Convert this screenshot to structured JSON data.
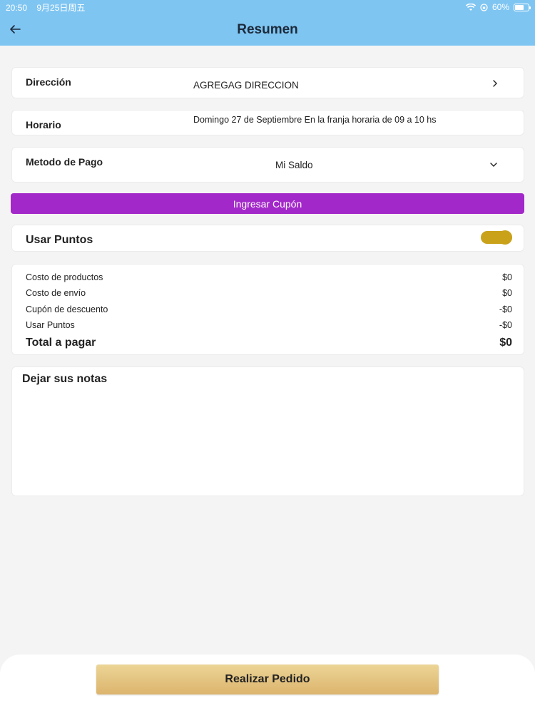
{
  "status_bar": {
    "time": "20:50",
    "date": "9月25日周五",
    "battery": "60%"
  },
  "header": {
    "title": "Resumen"
  },
  "address": {
    "label": "Dirección",
    "value": "AGREGAG DIRECCION"
  },
  "schedule": {
    "label": "Horario",
    "value": "Domingo 27 de Septiembre En la franja horaria de 09 a 10 hs"
  },
  "payment": {
    "label": "Metodo de Pago",
    "selected": "Mi Saldo"
  },
  "coupon_button": "Ingresar Cupón",
  "points": {
    "label": "Usar Puntos",
    "enabled": true,
    "toggle_color": "#c9a21a"
  },
  "summary": {
    "lines": [
      {
        "label": "Costo de productos",
        "value": "$0"
      },
      {
        "label": "Costo de envío",
        "value": "$0"
      },
      {
        "label": "Cupón de descuento",
        "value": "-$0"
      },
      {
        "label": "Usar Puntos",
        "value": "-$0"
      }
    ],
    "total_label": "Total a pagar",
    "total_value": "$0"
  },
  "notes": {
    "title": "Dejar sus notas",
    "value": ""
  },
  "submit_button": "Realizar Pedido",
  "colors": {
    "header": "#7fc5f2",
    "coupon": "#a328c9",
    "submit": "#dcb46d"
  }
}
